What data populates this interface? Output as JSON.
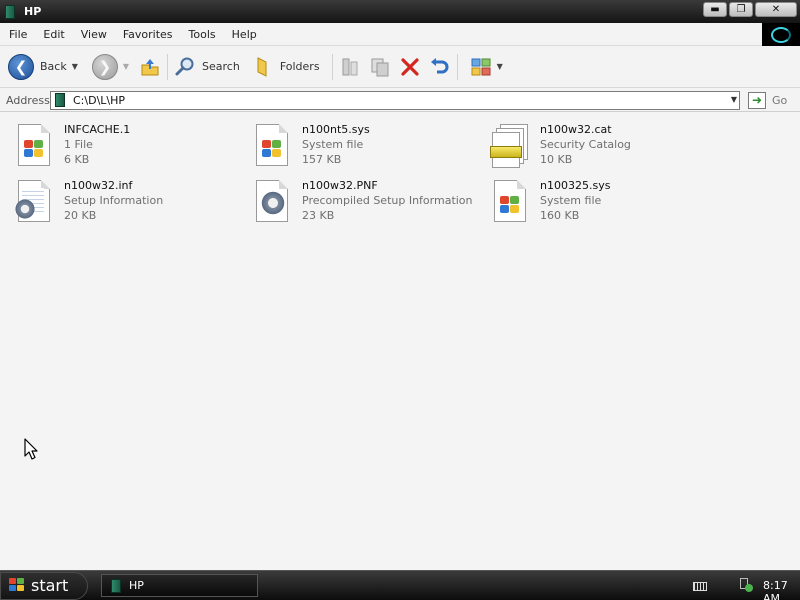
{
  "window": {
    "title": "HP",
    "buttons": {
      "minimize": "▬",
      "maximize": "❐",
      "close": "✕"
    }
  },
  "menu": [
    "File",
    "Edit",
    "View",
    "Favorites",
    "Tools",
    "Help"
  ],
  "toolbar": {
    "back_label": "Back",
    "search_label": "Search",
    "folders_label": "Folders"
  },
  "address": {
    "label": "Address",
    "path": "C:\\D\\L\\HP",
    "go_label": "Go"
  },
  "files": [
    {
      "name": "INFCACHE.1",
      "type": "1 File",
      "size": "6 KB",
      "icon": "windows-file-icon"
    },
    {
      "name": "n100nt5.sys",
      "type": "System file",
      "size": "157 KB",
      "icon": "windows-file-icon"
    },
    {
      "name": "n100w32.cat",
      "type": "Security Catalog",
      "size": "10 KB",
      "icon": "security-catalog-icon"
    },
    {
      "name": "n100w32.inf",
      "type": "Setup Information",
      "size": "20 KB",
      "icon": "setup-information-icon"
    },
    {
      "name": "n100w32.PNF",
      "type": "Precompiled Setup Information",
      "size": "23 KB",
      "icon": "precompiled-setup-icon"
    },
    {
      "name": "n100325.sys",
      "type": "System file",
      "size": "160 KB",
      "icon": "windows-file-icon"
    }
  ],
  "taskbar": {
    "start_label": "start",
    "task_label": "HP",
    "clock": "8:17 AM"
  }
}
